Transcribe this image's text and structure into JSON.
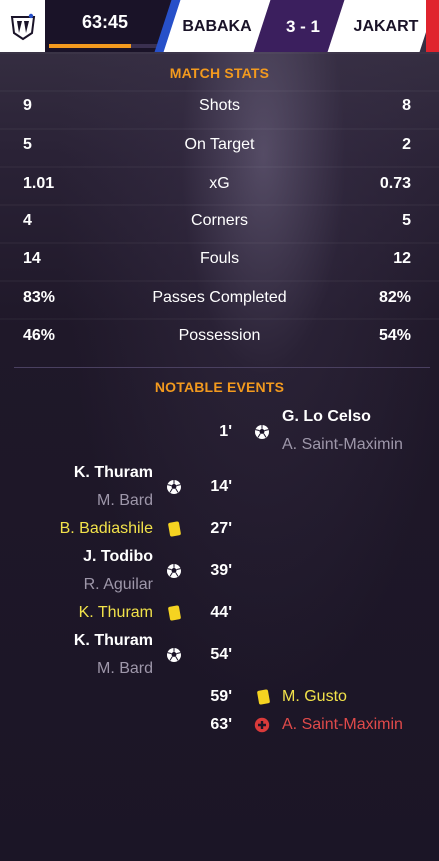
{
  "header": {
    "clock": "63:45",
    "clock_progress_fraction": 0.71,
    "home_team": "BABAKA",
    "score": "3 - 1",
    "away_team": "JAKART",
    "colors": {
      "accent": "#f39a1e",
      "home": "#2750c9",
      "away": "#e0242e",
      "score_bg": "#3b1f5e"
    }
  },
  "match_stats": {
    "title": "MATCH STATS",
    "rows": [
      {
        "label": "Shots",
        "home": "9",
        "away": "8"
      },
      {
        "label": "On Target",
        "home": "5",
        "away": "2"
      },
      {
        "label": "xG",
        "home": "1.01",
        "away": "0.73"
      },
      {
        "label": "Corners",
        "home": "4",
        "away": "5"
      },
      {
        "label": "Fouls",
        "home": "14",
        "away": "12"
      },
      {
        "label": "Passes Completed",
        "home": "83%",
        "away": "82%"
      },
      {
        "label": "Possession",
        "home": "46%",
        "away": "54%"
      }
    ]
  },
  "events": {
    "title": "NOTABLE EVENTS",
    "items": [
      {
        "minute": "1'",
        "side": "away",
        "type": "goal",
        "player": "G. Lo Celso",
        "assist": "A. Saint-Maximin"
      },
      {
        "minute": "14'",
        "side": "home",
        "type": "goal",
        "player": "K. Thuram",
        "assist": "M. Bard"
      },
      {
        "minute": "27'",
        "side": "home",
        "type": "yellow-card",
        "player": "B. Badiashile"
      },
      {
        "minute": "39'",
        "side": "home",
        "type": "goal",
        "player": "J. Todibo",
        "assist": "R. Aguilar"
      },
      {
        "minute": "44'",
        "side": "home",
        "type": "yellow-card",
        "player": "K. Thuram"
      },
      {
        "minute": "54'",
        "side": "home",
        "type": "goal",
        "player": "K. Thuram",
        "assist": "M. Bard"
      },
      {
        "minute": "59'",
        "side": "away",
        "type": "yellow-card",
        "player": "M. Gusto"
      },
      {
        "minute": "63'",
        "side": "away",
        "type": "injury",
        "player": "A. Saint-Maximin"
      }
    ]
  }
}
